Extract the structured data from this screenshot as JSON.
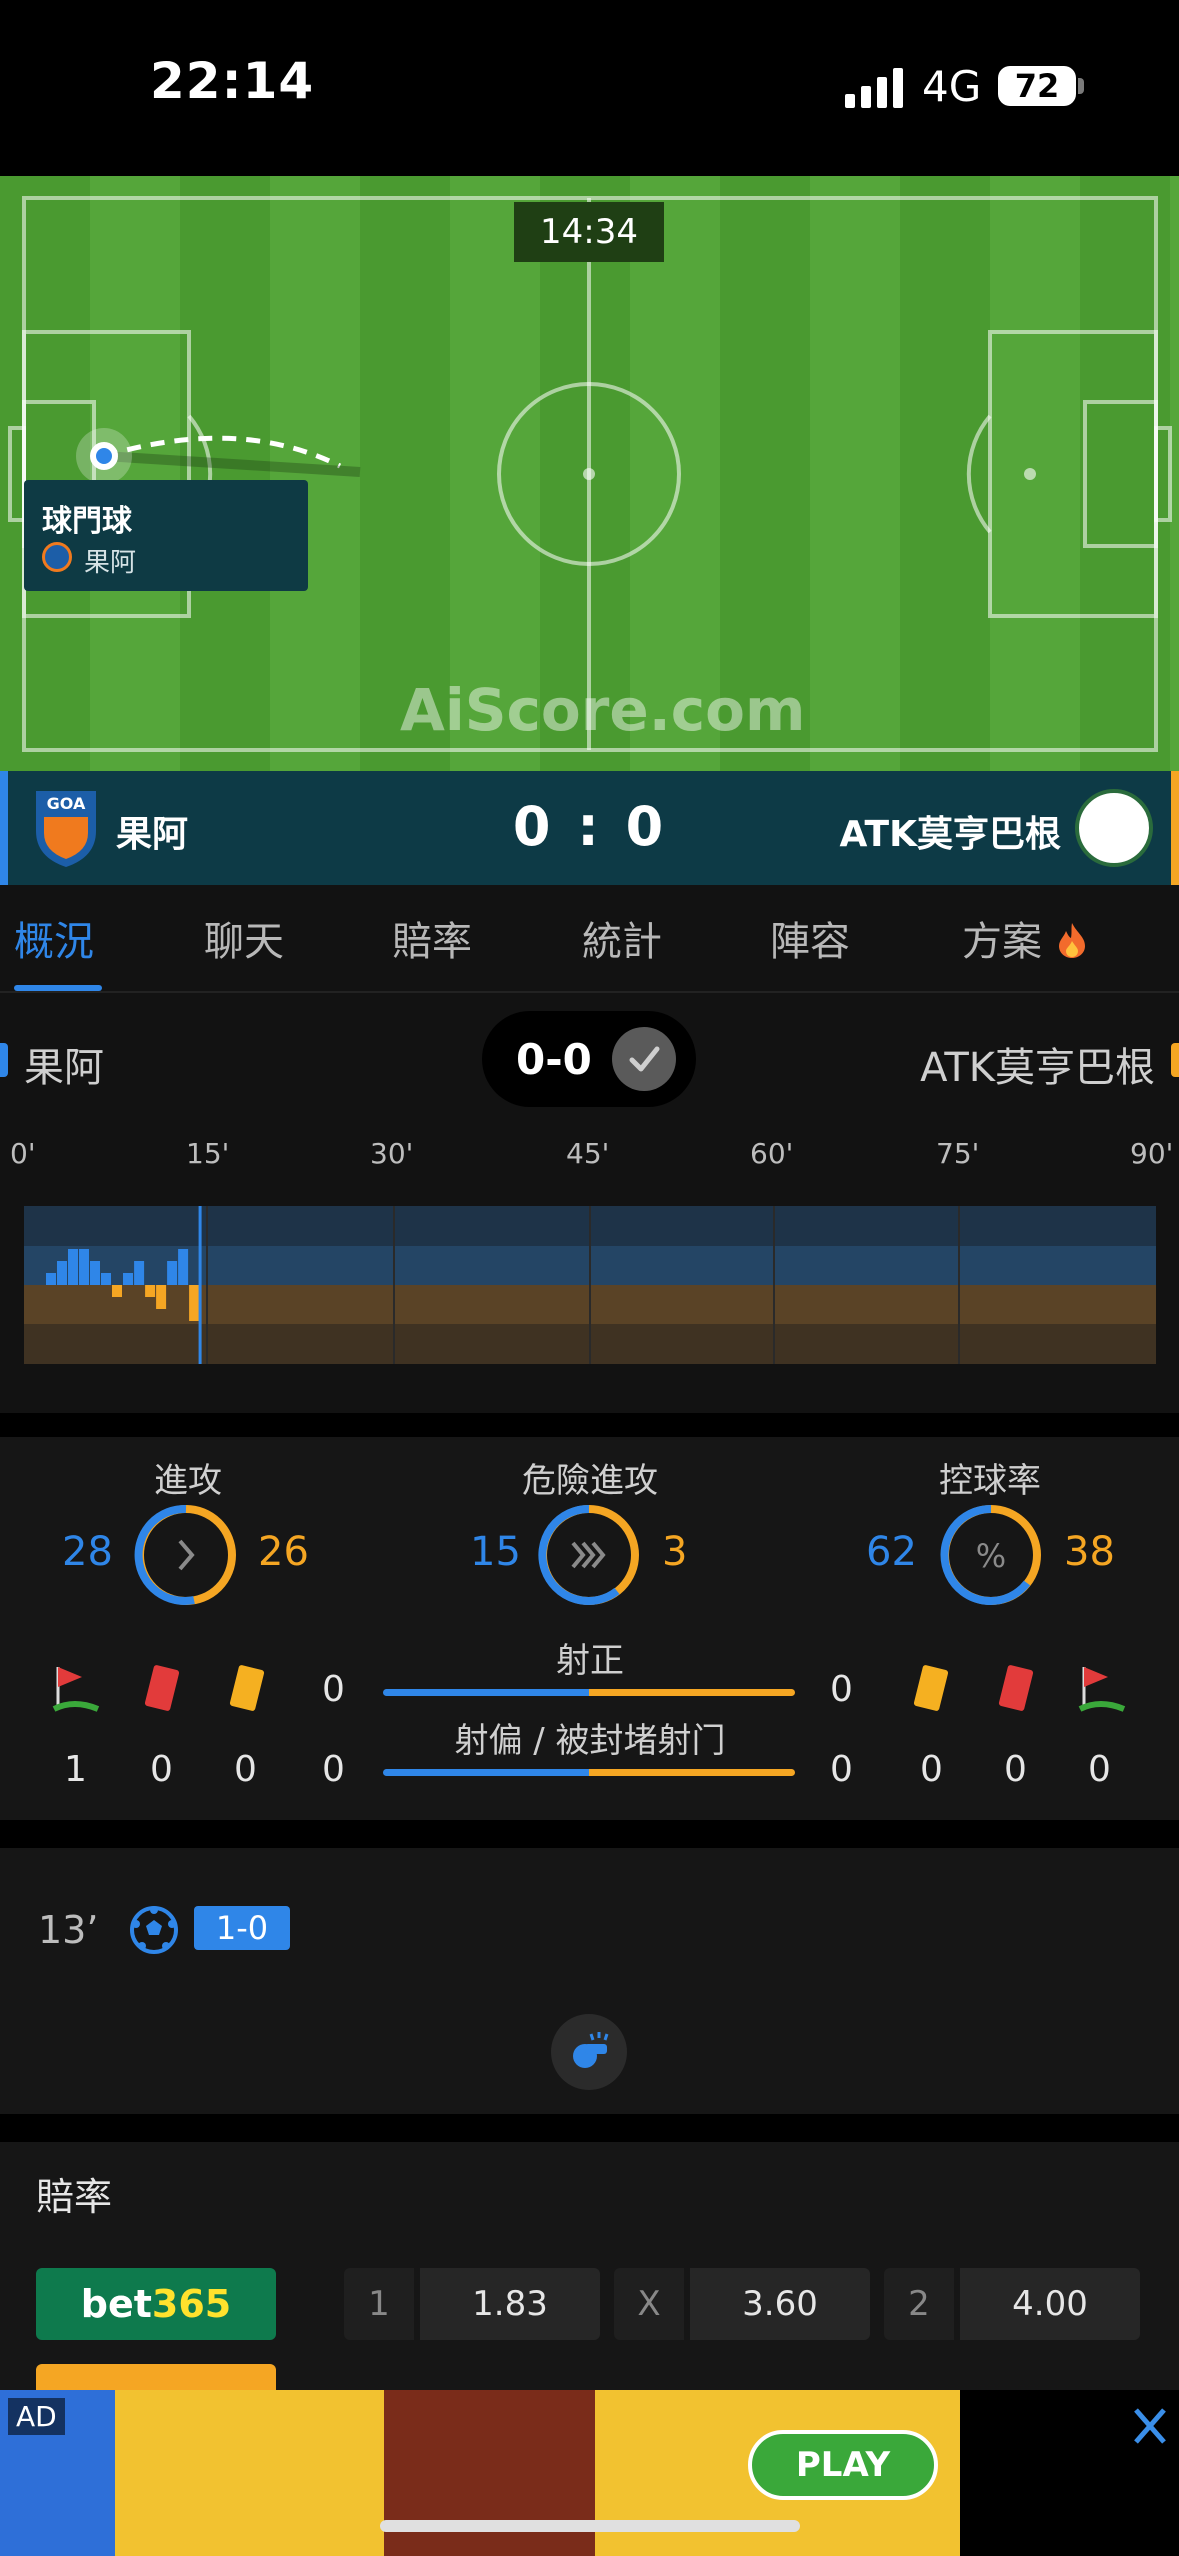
{
  "status_bar": {
    "time": "22:14",
    "network": "4G",
    "battery": "72"
  },
  "pitch": {
    "clock": "14:34",
    "event_title": "球門球",
    "event_team": "果阿",
    "watermark": "AiScore.com"
  },
  "scoreboard": {
    "home": "果阿",
    "score": "0 : 0",
    "away": "ATK莫亨巴根"
  },
  "tabs": [
    "概況",
    "聊天",
    "賠率",
    "統計",
    "陣容",
    "方案"
  ],
  "overview": {
    "home": "果阿",
    "away": "ATK莫亨巴根",
    "fulltime_score": "0-0"
  },
  "timeline_ticks": [
    "0'",
    "15'",
    "30'",
    "45'",
    "60'",
    "75'",
    "90'"
  ],
  "chart_data": {
    "type": "bar",
    "home_color": "#2f86e8",
    "away_color": "#f5a623",
    "x_ticks": [
      "0'",
      "15'",
      "30'",
      "45'",
      "60'",
      "75'",
      "90'"
    ],
    "home_pressure": [
      0,
      0,
      1,
      2,
      3,
      3,
      2,
      1,
      0,
      1,
      2,
      0,
      0,
      2,
      3,
      0
    ],
    "away_pressure": [
      0,
      0,
      0,
      0,
      0,
      0,
      0,
      0,
      1,
      0,
      0,
      1,
      2,
      0,
      0,
      3
    ],
    "current_minute": 14
  },
  "stats": {
    "attack_label": "進攻",
    "attack_home": "28",
    "attack_away": "26",
    "danger_label": "危險進攻",
    "danger_home": "15",
    "danger_away": "3",
    "possession_label": "控球率",
    "possession_home": "62",
    "possession_away": "38",
    "on_target_label": "射正",
    "on_target_home": "0",
    "on_target_away": "0",
    "off_target_label": "射偏 / 被封堵射门",
    "off_target_home": "0",
    "off_target_away": "0",
    "home_corners": "1",
    "home_red": "0",
    "home_yellow": "0",
    "away_yellow": "0",
    "away_red": "0",
    "away_corners": "0",
    "percent_symbol": "%"
  },
  "events": {
    "minute": "13’",
    "score": "1-0"
  },
  "odds": {
    "title": "賠率",
    "bookmaker_a": "bet",
    "bookmaker_b": "365",
    "home_key": "1",
    "home_val": "1.83",
    "draw_key": "X",
    "draw_val": "3.60",
    "away_key": "2",
    "away_val": "4.00"
  },
  "ad": {
    "tag": "AD",
    "play": "PLAY"
  }
}
